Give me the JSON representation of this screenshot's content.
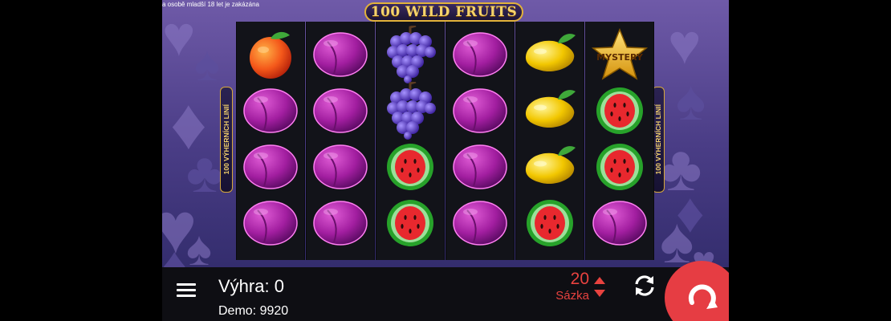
{
  "age_notice": "a osobě mladší 18 let je zakázána",
  "game": {
    "title": "100 WILD FRUITS",
    "paylines_label": "100 VÝHERNÍCH LINIÍ"
  },
  "symbols": {
    "mystery_label": "MYSTERY"
  },
  "reels": [
    [
      "orange-icon",
      "plum-icon",
      "plum-icon",
      "plum-icon"
    ],
    [
      "plum-icon",
      "plum-icon",
      "plum-icon",
      "plum-icon"
    ],
    [
      "grapes-icon",
      "grapes-icon",
      "watermelon-icon",
      "watermelon-icon"
    ],
    [
      "plum-icon",
      "plum-icon",
      "plum-icon",
      "plum-icon"
    ],
    [
      "lemon-icon",
      "lemon-icon",
      "lemon-icon",
      "watermelon-icon"
    ],
    [
      "mystery-star-icon",
      "watermelon-icon",
      "watermelon-icon",
      "plum-icon"
    ]
  ],
  "bottom_bar": {
    "win_label": "Výhra: 0",
    "demo_label": "Demo:",
    "demo_value": "9920",
    "bet_value": "20",
    "bet_label": "Sázka"
  },
  "colors": {
    "accent": "#e63d43",
    "gold": "#f5d36b",
    "bar_bg": "#0e0e13"
  }
}
